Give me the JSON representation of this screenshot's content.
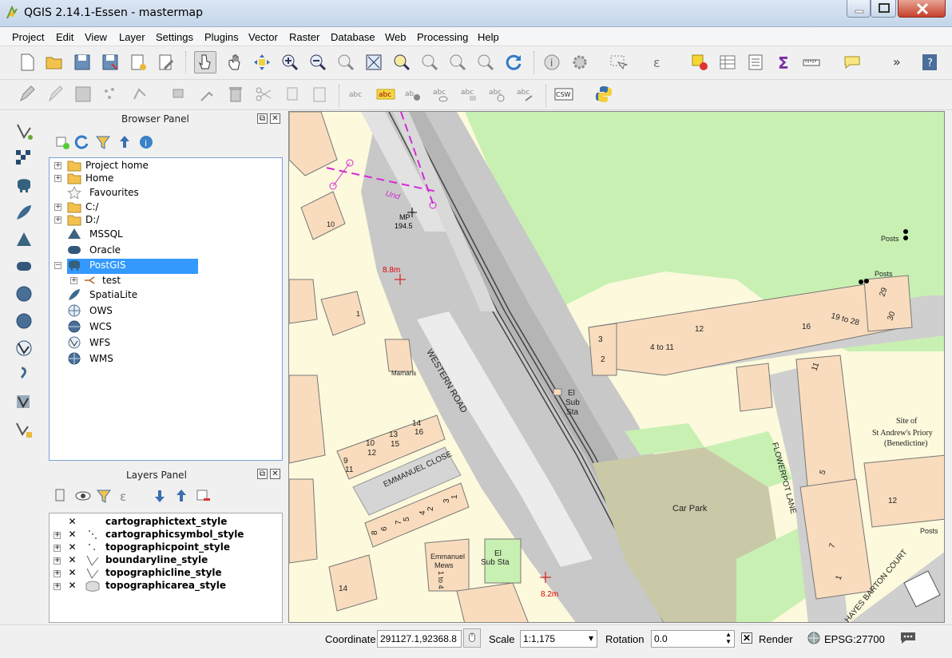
{
  "window": {
    "title": "QGIS 2.14.1-Essen - mastermap"
  },
  "menu": [
    "Project",
    "Edit",
    "View",
    "Layer",
    "Settings",
    "Plugins",
    "Vector",
    "Raster",
    "Database",
    "Web",
    "Processing",
    "Help"
  ],
  "browser": {
    "title": "Browser Panel",
    "items": [
      {
        "label": "Project home",
        "icon": "folder-icon",
        "expandable": true
      },
      {
        "label": "Home",
        "icon": "folder-icon",
        "expandable": true
      },
      {
        "label": "Favourites",
        "icon": "star-icon",
        "expandable": false
      },
      {
        "label": "C:/",
        "icon": "folder-icon",
        "expandable": true
      },
      {
        "label": "D:/",
        "icon": "folder-icon",
        "expandable": true
      },
      {
        "label": "MSSQL",
        "icon": "mssql-icon",
        "expandable": false
      },
      {
        "label": "Oracle",
        "icon": "oracle-icon",
        "expandable": false
      },
      {
        "label": "PostGIS",
        "icon": "postgis-icon",
        "expandable": true,
        "selected": true
      },
      {
        "label": "test",
        "icon": "connection-icon",
        "expandable": true,
        "child": true
      },
      {
        "label": "SpatiaLite",
        "icon": "spatialite-icon",
        "expandable": false
      },
      {
        "label": "OWS",
        "icon": "globe-icon",
        "expandable": false
      },
      {
        "label": "WCS",
        "icon": "globe-icon",
        "expandable": false
      },
      {
        "label": "WFS",
        "icon": "wfs-icon",
        "expandable": false
      },
      {
        "label": "WMS",
        "icon": "globe-icon",
        "expandable": false
      }
    ]
  },
  "layers": {
    "title": "Layers Panel",
    "items": [
      {
        "label": "cartographictext_style",
        "checked": true,
        "expandable": false
      },
      {
        "label": "cartographicsymbol_style",
        "checked": true,
        "expandable": true
      },
      {
        "label": "topographicpoint_style",
        "checked": true,
        "expandable": true
      },
      {
        "label": "boundaryline_style",
        "checked": true,
        "expandable": true
      },
      {
        "label": "topographicline_style",
        "checked": true,
        "expandable": true
      },
      {
        "label": "topographicarea_style",
        "checked": true,
        "expandable": true
      }
    ]
  },
  "map_labels": {
    "mp": "MP",
    "mp_val": "194.5",
    "spot1": "8.8m",
    "spot2": "8.2m",
    "und": "Und",
    "num10": "10",
    "num1": "1",
    "marnaris": "Marnaris",
    "western_road": "WESTERN ROAD",
    "emmanuel_close": "EMMANUEL CLOSE",
    "emmanuel_mews_1": "Emmanuel",
    "emmanuel_mews_2": "Mews",
    "mews_units": "1 to 4",
    "el_sub_sta_a1": "El",
    "el_sub_sta_a2": "Sub",
    "el_sub_sta_a3": "Sta",
    "el_sub_sta_b1": "El",
    "el_sub_sta_b2": "Sub Sta",
    "car_park": "Car Park",
    "flowerpot_lane": "FLOWERPOT LANE",
    "hayes_barton_court": "HAYES BARTON COURT",
    "posts_a": "Posts",
    "posts_b": "Posts",
    "posts_c": "Posts",
    "priory_1": "Site of",
    "priory_2": "St Andrew's Priory",
    "priory_3": "(Benedictine)",
    "n3": "3",
    "n2": "2",
    "n4to11": "4 to 11",
    "n12a": "12",
    "n16": "16",
    "n19to28": "19 to 28",
    "n29": "29",
    "n30": "30",
    "n11": "11",
    "n5": "5",
    "n7": "7",
    "n1b": "1",
    "n12b": "12",
    "n14": "14",
    "n10": "10",
    "n12c": "12",
    "n13": "13",
    "n14b": "14",
    "n15": "15",
    "n16b": "16",
    "n9": "9",
    "n11b": "11",
    "close_nums": [
      "8",
      "6",
      "7",
      "5",
      "4",
      "2",
      "3",
      "1"
    ]
  },
  "status": {
    "coordinate_label": "Coordinate",
    "coordinate_value": "291127.1,92368.8",
    "scale_label": "Scale",
    "scale_value": "1:1,175",
    "rotation_label": "Rotation",
    "rotation_value": "0.0",
    "render_label": "Render",
    "render_checked": true,
    "crs": "EPSG:27700"
  }
}
